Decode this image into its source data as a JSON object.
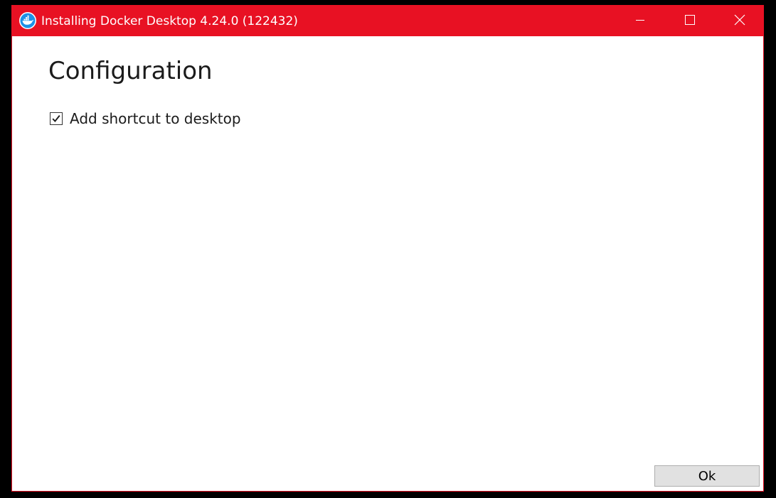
{
  "window": {
    "title": "Installing Docker Desktop 4.24.0 (122432)",
    "accent_color": "#e81123",
    "app_icon": "docker-whale-icon"
  },
  "caption_buttons": {
    "minimize_icon": "minimize-icon",
    "maximize_icon": "maximize-icon",
    "close_icon": "close-icon"
  },
  "content": {
    "heading": "Configuration",
    "options": [
      {
        "label": "Add shortcut to desktop",
        "checked": true
      }
    ]
  },
  "footer": {
    "ok_label": "Ok"
  }
}
